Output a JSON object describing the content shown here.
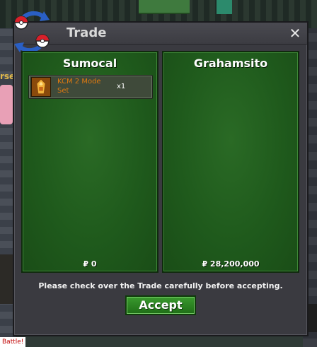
{
  "window": {
    "title": "Trade",
    "close_glyph": "✕"
  },
  "left_panel": {
    "name": "Sumocal",
    "items": [
      {
        "name": "KCM 2 Mode Set",
        "quantity": "x1",
        "icon": "costume-item-icon"
      }
    ],
    "money": "₽ 0"
  },
  "right_panel": {
    "name": "Grahamsito",
    "items": [],
    "money": "₽ 28,200,000"
  },
  "notice": "Please check over the Trade carefully before accepting.",
  "accept_label": "Accept",
  "background": {
    "left_text": "rse",
    "battle_label": "Battle!"
  },
  "colors": {
    "panel_green": "#1f5a1c",
    "window_gray": "#3a3a40",
    "item_name_orange": "#e07a10",
    "accept_green": "#2d8a24"
  }
}
